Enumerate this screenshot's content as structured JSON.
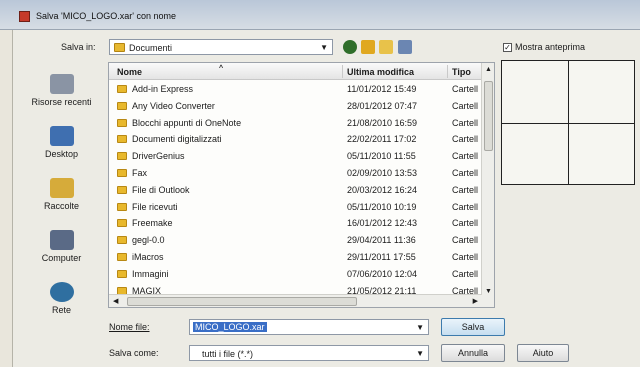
{
  "window": {
    "title": "Salva 'MICO_LOGO.xar' con nome"
  },
  "save_in": {
    "label": "Salva in:",
    "value": "Documenti"
  },
  "preview": {
    "label": "Mostra anteprima",
    "checked": true
  },
  "places": [
    {
      "label": "Risorse recenti"
    },
    {
      "label": "Desktop"
    },
    {
      "label": "Raccolte"
    },
    {
      "label": "Computer"
    },
    {
      "label": "Rete"
    }
  ],
  "columns": {
    "name": "Nome",
    "modified": "Ultima modifica",
    "type": "Tipo"
  },
  "files": [
    {
      "name": "Add-in Express",
      "date": "11/01/2012 15:49",
      "type": "Cartell"
    },
    {
      "name": "Any Video Converter",
      "date": "28/01/2012 07:47",
      "type": "Cartell"
    },
    {
      "name": "Blocchi appunti di OneNote",
      "date": "21/08/2010 16:59",
      "type": "Cartell"
    },
    {
      "name": "Documenti digitalizzati",
      "date": "22/02/2011 17:02",
      "type": "Cartell"
    },
    {
      "name": "DriverGenius",
      "date": "05/11/2010 11:55",
      "type": "Cartell"
    },
    {
      "name": "Fax",
      "date": "02/09/2010 13:53",
      "type": "Cartell"
    },
    {
      "name": "File di Outlook",
      "date": "20/03/2012 16:24",
      "type": "Cartell"
    },
    {
      "name": "File ricevuti",
      "date": "05/11/2010 10:19",
      "type": "Cartell"
    },
    {
      "name": "Freemake",
      "date": "16/01/2012 12:43",
      "type": "Cartell"
    },
    {
      "name": "gegl-0.0",
      "date": "29/04/2011 11:36",
      "type": "Cartell"
    },
    {
      "name": "iMacros",
      "date": "29/11/2011 17:55",
      "type": "Cartell"
    },
    {
      "name": "Immagini",
      "date": "07/06/2010 12:04",
      "type": "Cartell"
    },
    {
      "name": "MAGIX",
      "date": "21/05/2012 21:11",
      "type": "Cartell"
    }
  ],
  "filename": {
    "label": "Nome file:",
    "value": "MICO_LOGO.xar"
  },
  "save_as": {
    "label": "Salva come:",
    "value": "tutti i file (*.*)"
  },
  "buttons": {
    "save": "Salva",
    "cancel": "Annulla",
    "help": "Aiuto"
  },
  "colors": {
    "selection": "#3a6ec6",
    "folder": "#e8b82c"
  }
}
